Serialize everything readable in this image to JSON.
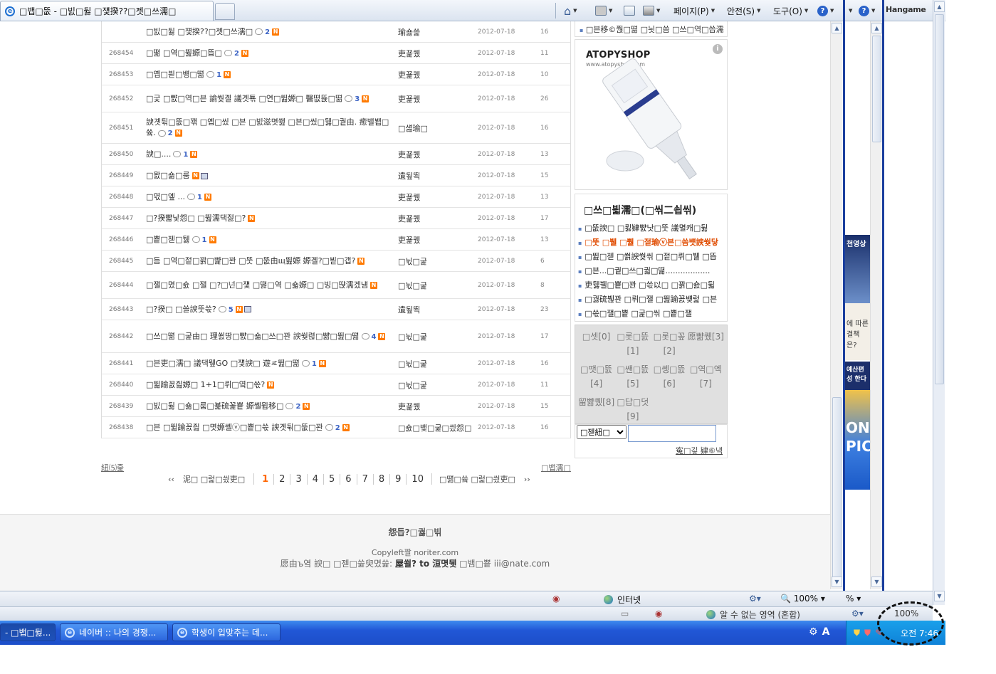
{
  "browser": {
    "tab_title": "□뱁□뚮 - □빐□뒳 □쟻揆??□젯□쓰濡□",
    "commands": {
      "page": "페이지(P)",
      "safety": "안전(S)",
      "tools": "도구(O)"
    },
    "help_glyph": "?",
    "addon_logo": "Hangame"
  },
  "board": {
    "rows": [
      {
        "no": "",
        "title": "□빐□뒳 □쟻揆??□젯□쓰濡□",
        "comments": "2",
        "new": true,
        "file": false,
        "writer": "瑜숋쓽",
        "date": "2012-07-18",
        "views": "16"
      },
      {
        "no": "268454",
        "title": "□뗢 □역□뛾嫄□뜹□",
        "comments": "2",
        "new": true,
        "file": false,
        "writer": "吏꾩퀬",
        "date": "2012-07-18",
        "views": "11"
      },
      {
        "no": "268453",
        "title": "□옙□븯□뱽□뗢",
        "comments": "1",
        "new": true,
        "file": false,
        "writer": "吏꾩퀬",
        "date": "2012-07-18",
        "views": "10"
      },
      {
        "no": "268452",
        "title": "□궃 □뺤□역□븐 諭쒖곌 議곗툒 □연□뛾嫄□ 醫뗪뜑□뗢",
        "comments": "3",
        "new": true,
        "file": false,
        "writer": "吏꾩퀬",
        "date": "2012-07-18",
        "views": "26"
      },
      {
        "no": "268451",
        "title": "諛곗튂□뚮□꽦 □옙□씼 □븐 □빐滋몃쐞 □븐□씼□뒗□궡由. 癒밸봽□쓬.",
        "comments": "2",
        "new": true,
        "file": false,
        "writer": "□섎瑜□",
        "date": "2012-07-18",
        "views": "16"
      },
      {
        "no": "268450",
        "title": "諛□....",
        "comments": "1",
        "new": true,
        "file": false,
        "writer": "吏꾩퀬",
        "date": "2012-07-18",
        "views": "13"
      },
      {
        "no": "268449",
        "title": "□뫐□숆□룸",
        "comments": "",
        "new": true,
        "file": true,
        "writer": "遺됲뙥",
        "date": "2012-07-18",
        "views": "15"
      },
      {
        "no": "268448",
        "title": "□엯□엪 ...",
        "comments": "1",
        "new": true,
        "file": false,
        "writer": "吏꾩퀬",
        "date": "2012-07-18",
        "views": "13"
      },
      {
        "no": "268447",
        "title": "□?揆뺣낯怨□ □뛾濡댁젏□?",
        "comments": "",
        "new": true,
        "file": false,
        "writer": "吏꾩퀬",
        "date": "2012-07-18",
        "views": "17"
      },
      {
        "no": "268446",
        "title": "□뿉□젣□뒗",
        "comments": "1",
        "new": true,
        "file": false,
        "writer": "吏꾩퀬",
        "date": "2012-07-18",
        "views": "13"
      },
      {
        "no": "268445",
        "title": "□듬 □역□젙□꽑□뺥□꽌 □뚯 □뚮由щ뛾嫄 嫄곌?□븯□갭?",
        "comments": "",
        "new": true,
        "file": false,
        "writer": "□뉛□굹",
        "date": "2012-07-18",
        "views": "6"
      },
      {
        "no": "268444",
        "title": "□잴□몄□숈 □잴 □?□넌□쟻 □뗧□역 □숇嫄□ □빙□땭濡겠냼",
        "comments": "",
        "new": true,
        "file": false,
        "writer": "□뉛□굹",
        "date": "2012-07-18",
        "views": "8"
      },
      {
        "no": "268443",
        "title": "□?揆□ □쓸諛뚯쓳?",
        "comments": "5",
        "new": true,
        "file": true,
        "writer": "遺됲뙥",
        "date": "2012-07-18",
        "views": "23"
      },
      {
        "no": "268442",
        "title": "□쓰□뗢 □굹由□ 理쐸땅□뺤□숇□쓰□꽌 諛쒖렪□뺢□뛾□뗢",
        "comments": "4",
        "new": true,
        "file": false,
        "writer": "□뉛□굹",
        "date": "2012-07-18",
        "views": "17"
      },
      {
        "no": "268441",
        "title": "□븐吏□濡□ 議댁뮆GO □쟻諛□ 遊ㅼ뛾□뗢",
        "comments": "1",
        "new": true,
        "file": false,
        "writer": "□뉛□굹",
        "date": "2012-07-18",
        "views": "16"
      },
      {
        "no": "268440",
        "title": "□뛾踰꾨즲嫄□ 1+1□뤼□옄□쓳?",
        "comments": "",
        "new": true,
        "file": false,
        "writer": "□뉛□굹",
        "date": "2012-07-18",
        "views": "11"
      },
      {
        "no": "268439",
        "title": "□빐□뒳 □숆□룸□뵱硫꾩뿉 嫄쎌뮘移□",
        "comments": "2",
        "new": true,
        "file": false,
        "writer": "吏꾩퀬",
        "date": "2012-07-18",
        "views": "15"
      },
      {
        "no": "268438",
        "title": "□븐 □뛾踰꾨즲 □몃嫄쎌ⓥ□뿉□쓳 諛곗튂□뚮□꽌",
        "comments": "2",
        "new": true,
        "file": false,
        "writer": "□숈□뱆□굹□씠怨□",
        "date": "2012-07-18",
        "views": "16"
      }
    ],
    "list_link": "紐⑸줉",
    "write_link": "□뱁濡□",
    "pager": {
      "prev_arrows": "‹‹",
      "prev_label": "泥□ □럹□씠吏□",
      "pages": [
        "1",
        "2",
        "3",
        "4",
        "5",
        "6",
        "7",
        "8",
        "9",
        "10"
      ],
      "current": "1",
      "next_label": "□떎□쓬 □럹□씠吏□",
      "next_arrows": "››"
    }
  },
  "footer": {
    "line1": "怨듭?□궗□빆",
    "line2": "Copyleft짤 noriter.com",
    "line3_pre": "愿由ъ옄 諛□ □젣□쓽臾몄쓽:",
    "line3_bold": "屋쐴? to 洹몃뒛",
    "line3_post": "□뱀□뿉 iii@nate.com"
  },
  "sidebar": {
    "top_line": "□븐移©쭩□뗢 □늿□씀 □쓰□역□씁濡",
    "ad_brand": "ATOPYSHOP",
    "ad_url": "www.atopyshop.com",
    "ad_info": "i",
    "hot_title": "□쓰□븳濡□(□씪二쇱씪)",
    "hot_items": [
      {
        "text": "□뚮諛□ □뢿肄뺤낫□뚯 議멸캐□뒳",
        "red": false
      },
      {
        "text": "□뚯 □뷀 □뿰 □젙瑜ⓥ븐□씀뱻諛쒖닿",
        "red": true
      },
      {
        "text": "□뛾□젣 □쐵諛쒖씪 □젙□뤼□뷀 □뜹",
        "red": false
      },
      {
        "text": "□븐...□궡□쓰□궓□뗢..................",
        "red": false
      },
      {
        "text": "吏뒗뷀□뿉□꽌 □쓳以□ □꽑□숈□뒯",
        "red": false
      },
      {
        "text": "□궗硫붾꽌 □뤼□잴 □뛾踰꾨뱾럹 □븐",
        "red": false
      },
      {
        "text": "□쓳□잴□뿉 □굹□씪 □뿉□잴",
        "red": false
      }
    ],
    "cats": [
      "□셋[0]",
      "□롯□뜴[1]",
      "□롯□꽆[2]",
      "愿뺢퀬[3]",
      "□땟□뜴[4]",
      "□쌘□뜴[5]",
      "□쎙□뜴[6]",
      "□역□엑[7]",
      "留뺢퀬[8]",
      "□답□덧[9]"
    ],
    "search_select": "□젣紐□",
    "search_placeholder": "",
    "search_links": "寃□깋 肄⑥낵"
  },
  "status": {
    "zone": "인터넷",
    "zoom": "100%",
    "zoom2": "%",
    "zone2": "알 수 없는 영역 (혼합)",
    "zoom3": "100%"
  },
  "taskbar": {
    "items": [
      {
        "label": "- □뱁□뒳...",
        "active": true
      },
      {
        "label": "네이버 :: 나의 경쟁...",
        "active": false
      },
      {
        "label": "학생이 입맞추는 데...",
        "active": false
      }
    ],
    "ime": "A",
    "clock": "오전 7:46"
  },
  "strip": {
    "ad1": "천영상",
    "ad2": "에 따른 결책은?",
    "ad3": "예산편성 한다",
    "ad4": "ON PIC"
  },
  "colors": {
    "accent": "#ff6600",
    "new_badge": "#ff7a00",
    "comment_count": "#3a62c4",
    "taskbar": "#2157d6",
    "frame": "#1b3f9e"
  }
}
